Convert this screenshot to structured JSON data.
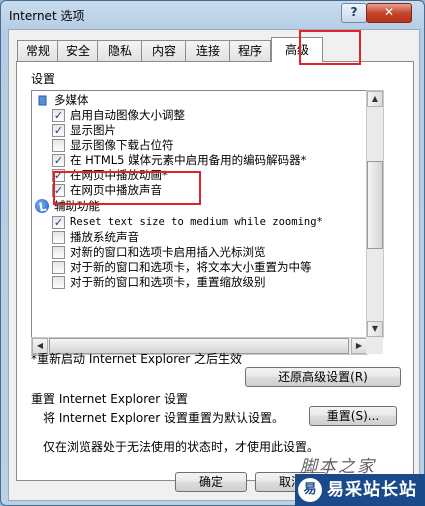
{
  "window": {
    "title": "Internet 选项",
    "help_label": "?",
    "close_label": "✕"
  },
  "tabs": [
    {
      "label": "常规"
    },
    {
      "label": "安全"
    },
    {
      "label": "隐私"
    },
    {
      "label": "内容"
    },
    {
      "label": "连接"
    },
    {
      "label": "程序"
    },
    {
      "label": "高级",
      "active": true
    }
  ],
  "settings": {
    "heading": "设置",
    "items": [
      {
        "kind": "group",
        "label": "多媒体",
        "icon": "folder-icon"
      },
      {
        "kind": "checkbox",
        "label": "启用自动图像大小调整",
        "checked": true
      },
      {
        "kind": "checkbox",
        "label": "显示图片",
        "checked": true
      },
      {
        "kind": "checkbox",
        "label": "显示图像下载占位符",
        "checked": false
      },
      {
        "kind": "checkbox",
        "label": "在 HTML5 媒体元素中启用备用的编码解码器*",
        "checked": true
      },
      {
        "kind": "checkbox",
        "label": "在网页中播放动画*",
        "checked": true
      },
      {
        "kind": "checkbox",
        "label": "在网页中播放声音",
        "checked": true
      },
      {
        "kind": "group",
        "label": "辅助功能",
        "icon": "accessibility-icon"
      },
      {
        "kind": "checkbox",
        "label": "Reset text size to medium while zooming*",
        "checked": true
      },
      {
        "kind": "checkbox",
        "label": "播放系统声音",
        "checked": false
      },
      {
        "kind": "checkbox",
        "label": "对新的窗口和选项卡启用插入光标浏览",
        "checked": false
      },
      {
        "kind": "checkbox",
        "label": "对于新的窗口和选项卡，将文本大小重置为中等",
        "checked": false
      },
      {
        "kind": "checkbox",
        "label": "对于新的窗口和选项卡，重置缩放级别",
        "checked": false
      }
    ],
    "restart_note": "*重新启动 Internet Explorer 之后生效",
    "restore_button": "还原高级设置(R)"
  },
  "reset": {
    "heading": "重置 Internet Explorer 设置",
    "description": "将 Internet Explorer 设置重置为默认设置。",
    "button": "重置(S)...",
    "note": "仅在浏览器处于无法使用的状态时，才使用此设置。"
  },
  "footer": {
    "ok": "确定",
    "cancel": "取消"
  },
  "watermark": "脚本之家",
  "brand": {
    "logo": "易",
    "text": "易采站长站"
  },
  "colors": {
    "highlight": "#e0242b"
  }
}
